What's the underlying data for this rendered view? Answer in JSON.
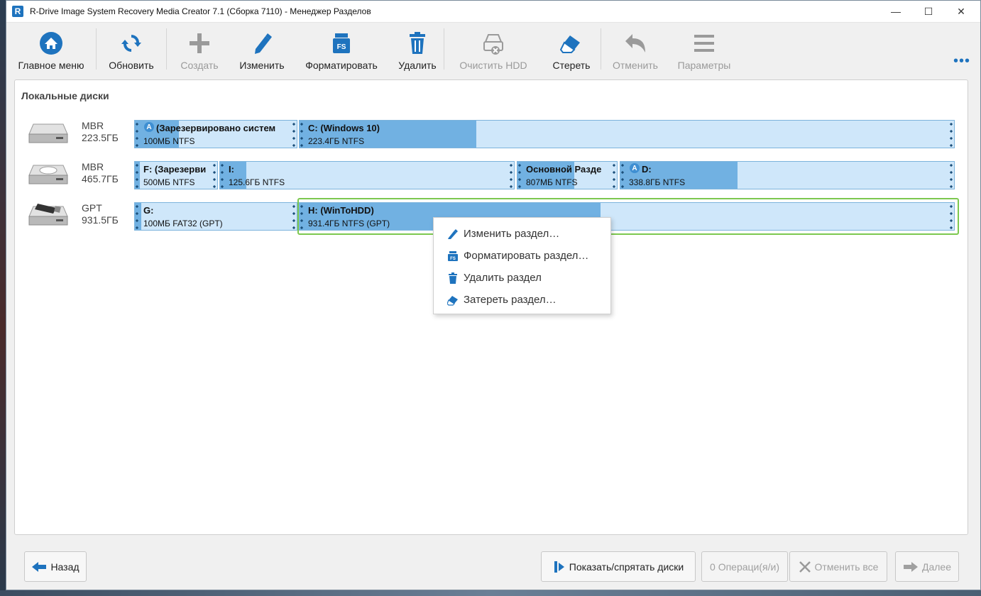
{
  "window": {
    "title": "R-Drive Image System Recovery Media Creator 7.1 (Сборка 7110) - Менеджер Разделов",
    "app_icon_letter": "R",
    "minimize": "—",
    "maximize": "☐",
    "close": "✕"
  },
  "toolbar": {
    "main_menu": "Главное меню",
    "refresh": "Обновить",
    "create": "Создать",
    "edit": "Изменить",
    "format": "Форматировать",
    "delete": "Удалить",
    "clean_hdd": "Очистить HDD",
    "wipe": "Стереть",
    "undo": "Отменить",
    "settings": "Параметры",
    "more": "•••",
    "format_icon_text": "FS"
  },
  "panel": {
    "title": "Локальные диски"
  },
  "disks": [
    {
      "type": "MBR",
      "size": "223.5ГБ",
      "partitions": [
        {
          "name": "(Зарезервировано систем",
          "info": "100МБ NTFS",
          "os_badge": "A",
          "used": 0.27
        },
        {
          "name": "C: (Windows 10)",
          "info": "223.4ГБ NTFS",
          "used": 0.27
        }
      ]
    },
    {
      "type": "MBR",
      "size": "465.7ГБ",
      "partitions": [
        {
          "name": "F: (Зарезерви",
          "info": "500МБ NTFS",
          "used": 0.06
        },
        {
          "name": "I:",
          "info": "125.6ГБ NTFS",
          "used": 0.09
        },
        {
          "name": "Основной Разде",
          "info": "807МБ NTFS",
          "used": 0.57
        },
        {
          "name": "D:",
          "info": "338.8ГБ NTFS",
          "os_badge": "A",
          "used": 0.35
        }
      ]
    },
    {
      "type": "GPT",
      "size": "931.5ГБ",
      "partitions": [
        {
          "name": "G:",
          "info": "100МБ FAT32 (GPT)",
          "used": 0.04
        },
        {
          "name": "H: (WinToHDD)",
          "info": "931.4ГБ NTFS (GPT)",
          "used": 0.46
        }
      ]
    }
  ],
  "context_menu": {
    "items": [
      {
        "label": "Изменить раздел…",
        "icon": "pencil-icon"
      },
      {
        "label": "Форматировать раздел…",
        "icon": "format-icon"
      },
      {
        "label": "Удалить раздел",
        "icon": "trash-icon"
      },
      {
        "label": "Затереть раздел…",
        "icon": "eraser-icon"
      }
    ],
    "format_icon_text": "FS"
  },
  "bottom": {
    "back": "Назад",
    "show_hide_disks": "Показать/спрятать диски",
    "operations": "0 Операци(я/и)",
    "cancel_all": "Отменить все",
    "next": "Далее"
  },
  "colors": {
    "accent": "#1e73be",
    "partition_used": "#71b1e2",
    "partition_free": "#cfe7fa",
    "selection": "#7cc84f"
  }
}
